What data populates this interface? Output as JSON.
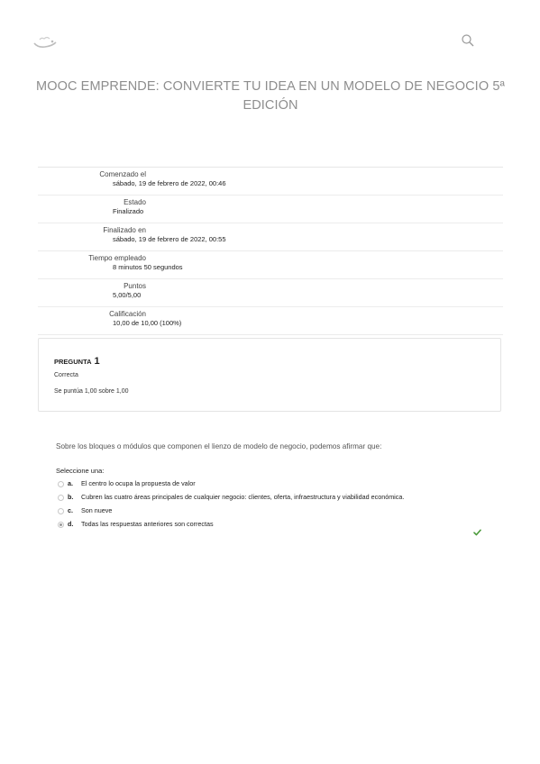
{
  "header": {
    "logo_icon": "cloud-logo-icon",
    "search_icon": "search-icon"
  },
  "page": {
    "title": "MOOC EMPRENDE: CONVIERTE TU IDEA EN UN MODELO DE NEGOCIO 5ª EDICIÓN"
  },
  "summary": [
    {
      "label": "Comenzado el",
      "value": "sábado, 19 de febrero de 2022, 00:46"
    },
    {
      "label": "Estado",
      "value": "Finalizado"
    },
    {
      "label": "Finalizado en",
      "value": "sábado, 19 de febrero de 2022, 00:55"
    },
    {
      "label": "Tiempo empleado",
      "value": "8 minutos 50 segundos"
    },
    {
      "label": "Puntos",
      "value": "5,00/5,00"
    },
    {
      "label": "Calificación",
      "value": "10,00 de 10,00 (100%)"
    }
  ],
  "question": {
    "heading": "PREGUNTA",
    "number": "1",
    "state": "Correcta",
    "grade": "Se puntúa 1,00 sobre 1,00",
    "text": "Sobre los bloques o módulos que componen el lienzo de modelo de negocio, podemos afirmar que:",
    "prompt": "Seleccione una:",
    "answers": [
      {
        "letter": "a.",
        "text": "El centro lo ocupa la propuesta de valor",
        "selected": false
      },
      {
        "letter": "b.",
        "text": "Cubren las cuatro áreas principales de cualquier negocio: clientes, oferta, infraestructura y viabilidad económica.",
        "selected": false
      },
      {
        "letter": "c.",
        "text": "Son nueve",
        "selected": false
      },
      {
        "letter": "d.",
        "text": "Todas las respuestas anteriores son correctas",
        "selected": true
      }
    ],
    "correct_icon": "check-icon",
    "correct_color": "#4a9a3a"
  }
}
